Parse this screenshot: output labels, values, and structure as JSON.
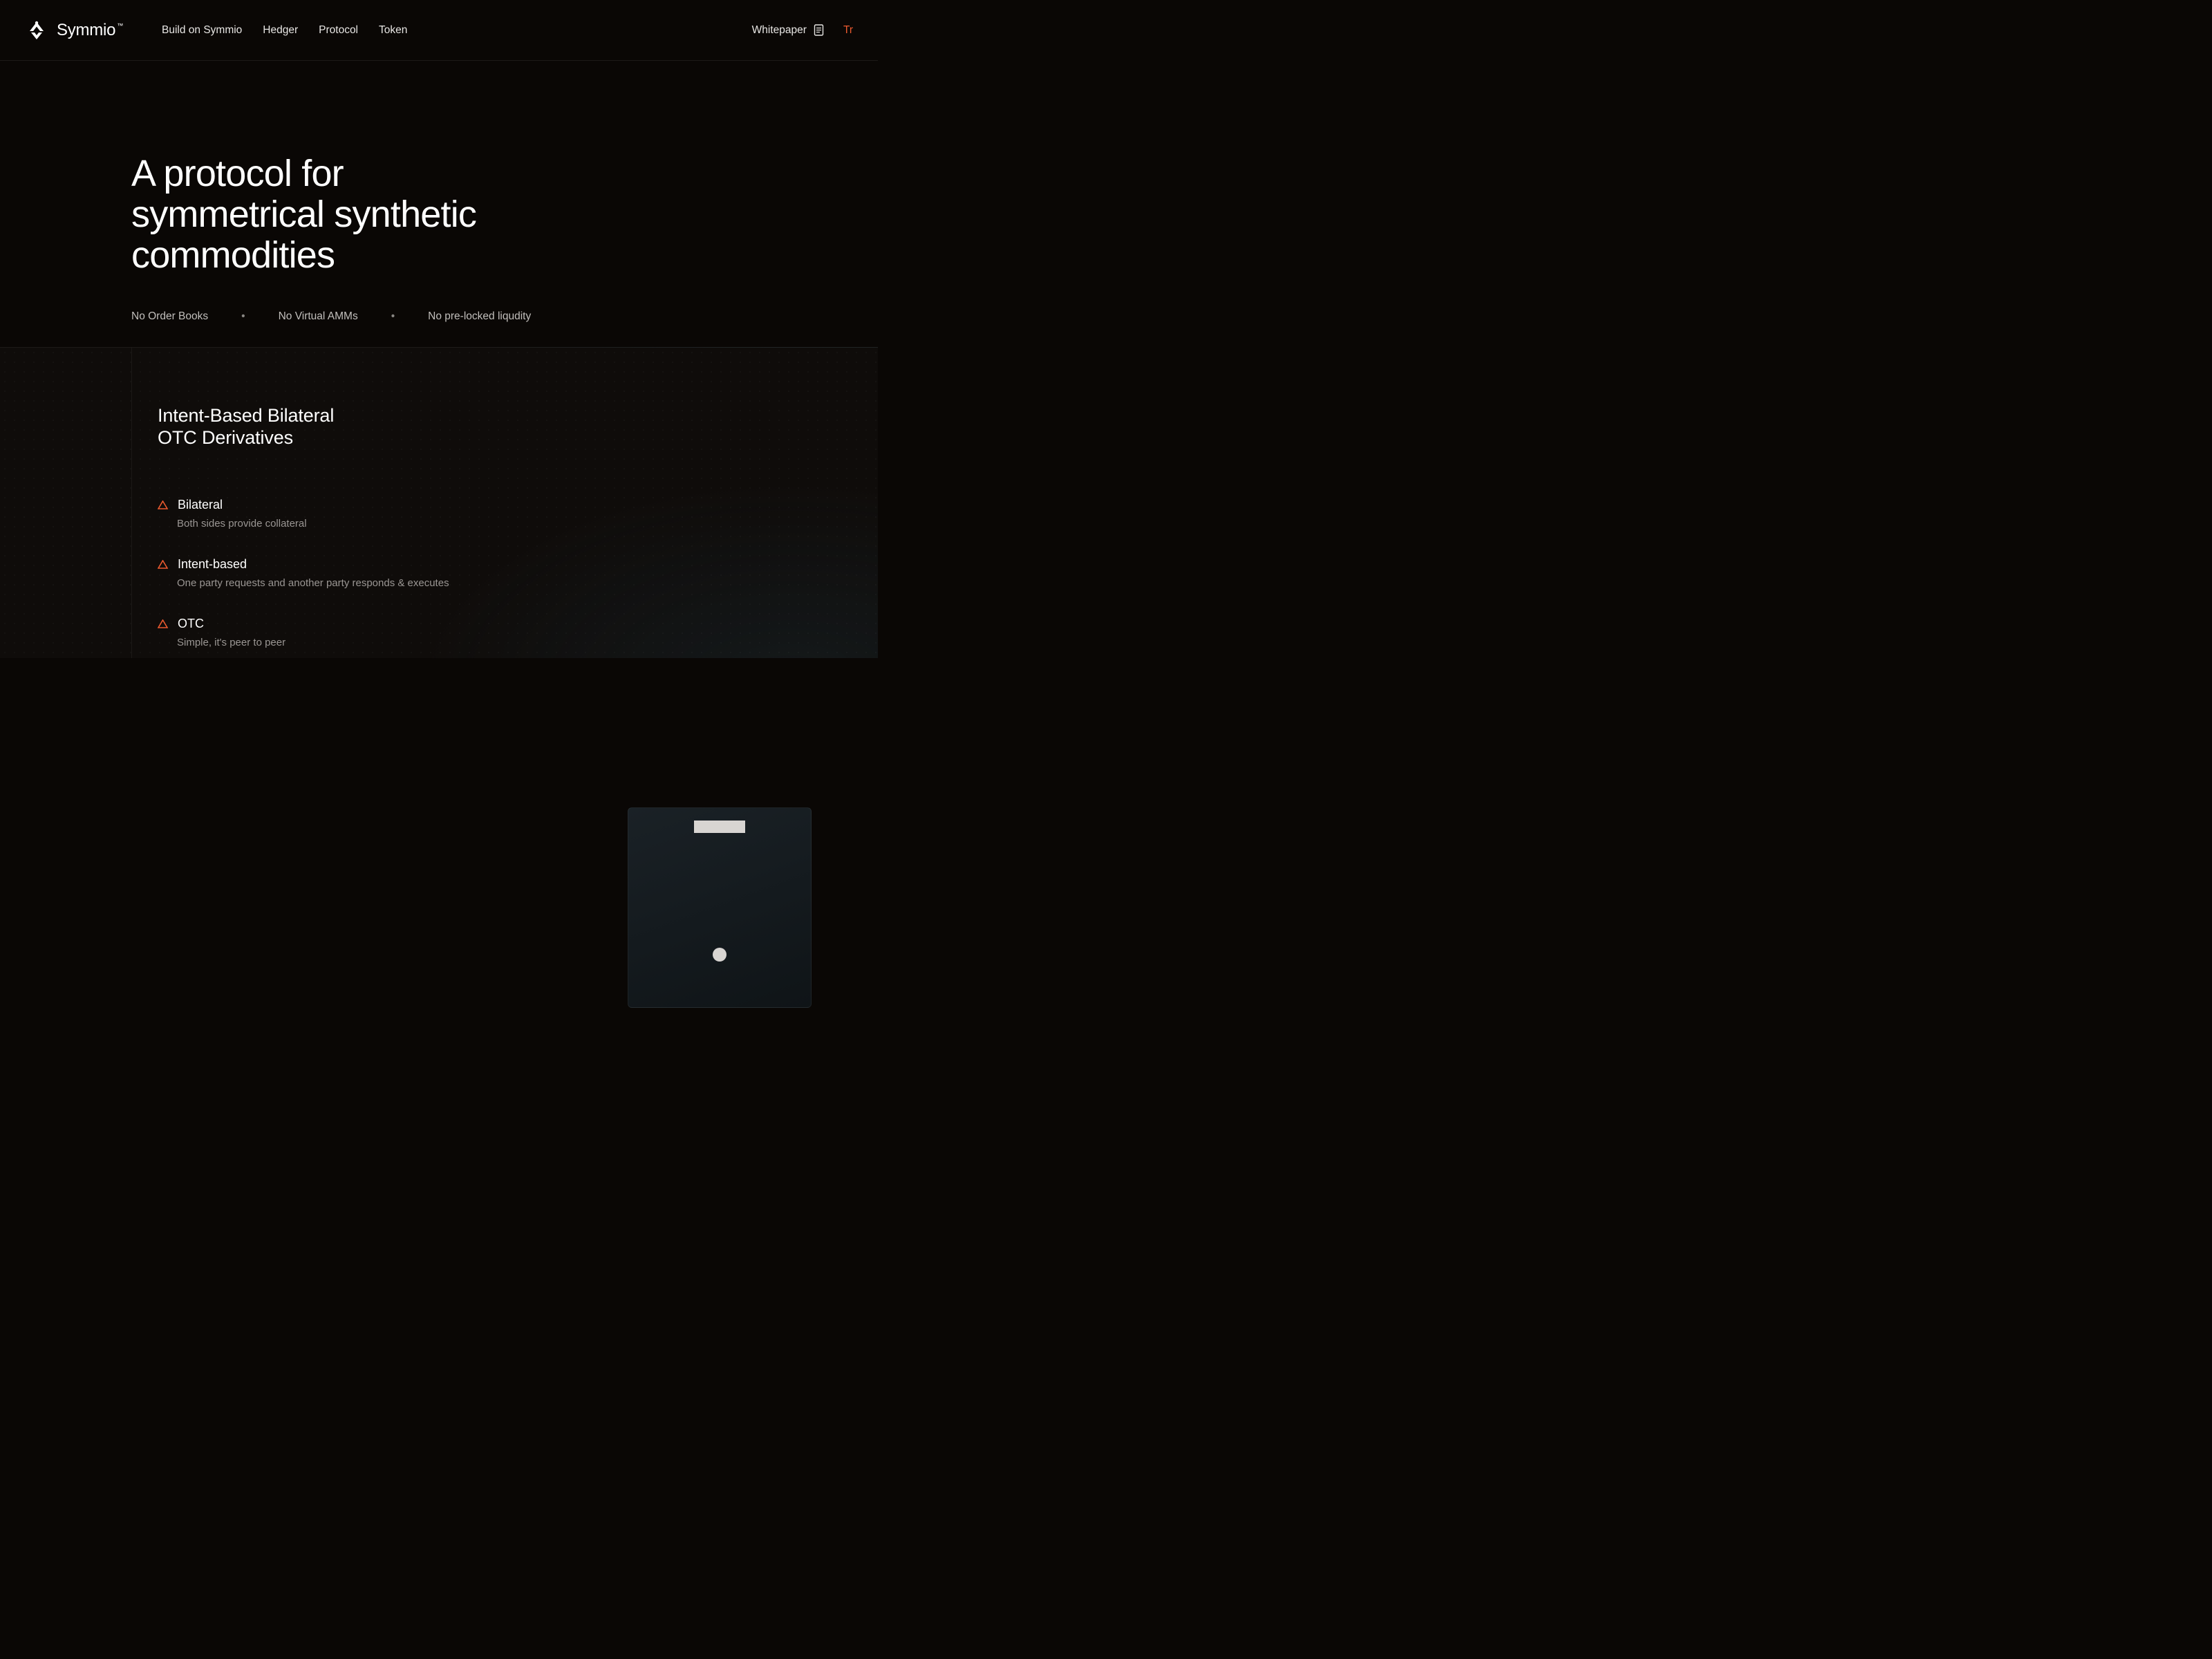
{
  "header": {
    "brand": "Symmio",
    "nav": [
      {
        "label": "Build on Symmio"
      },
      {
        "label": "Hedger"
      },
      {
        "label": "Protocol"
      },
      {
        "label": "Token"
      }
    ],
    "whitepaper": "Whitepaper",
    "trade": "Tr"
  },
  "hero": {
    "title_line1": "A protocol for",
    "title_line2": "symmetrical synthetic",
    "title_line3": "commodities",
    "bullets": [
      "No Order Books",
      "No Virtual AMMs",
      "No pre-locked liqudity"
    ]
  },
  "features": {
    "title_line1": "Intent-Based Bilateral",
    "title_line2": "OTC Derivatives",
    "items": [
      {
        "name": "Bilateral",
        "desc": "Both sides provide collateral"
      },
      {
        "name": "Intent-based",
        "desc": "One party requests and another party responds & executes"
      },
      {
        "name": "OTC",
        "desc": "Simple, it's peer to peer"
      }
    ]
  }
}
